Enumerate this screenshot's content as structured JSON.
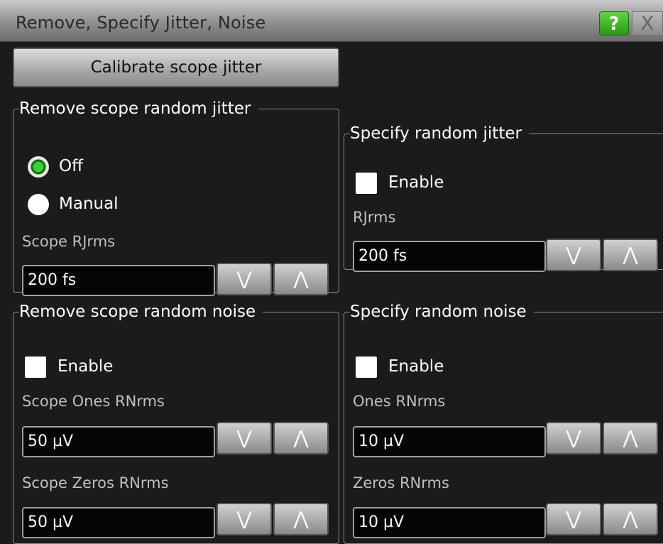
{
  "window": {
    "title": "Remove, Specify Jitter, Noise",
    "help_label": "?",
    "close_label": "X"
  },
  "calibrate_button": "Calibrate scope jitter",
  "remove_jitter": {
    "legend": "Remove scope random jitter",
    "option_off": "Off",
    "option_manual": "Manual",
    "selected": "Off",
    "field_label": "Scope RJrms",
    "value": "200 fs"
  },
  "specify_jitter": {
    "legend": "Specify random jitter",
    "enable_label": "Enable",
    "enabled": false,
    "field_label": "RJrms",
    "value": "200 fs"
  },
  "remove_noise": {
    "legend": "Remove scope random noise",
    "enable_label": "Enable",
    "enabled": false,
    "ones_label": "Scope Ones RNrms",
    "ones_value": "50 µV",
    "zeros_label": "Scope Zeros RNrms",
    "zeros_value": "50 µV"
  },
  "specify_noise": {
    "legend": "Specify random noise",
    "enable_label": "Enable",
    "enabled": false,
    "ones_label": "Ones RNrms",
    "ones_value": "10 µV",
    "zeros_label": "Zeros RNrms",
    "zeros_value": "10 µV"
  },
  "spinner": {
    "down_symbol": "⋁",
    "up_symbol": "⋀"
  }
}
